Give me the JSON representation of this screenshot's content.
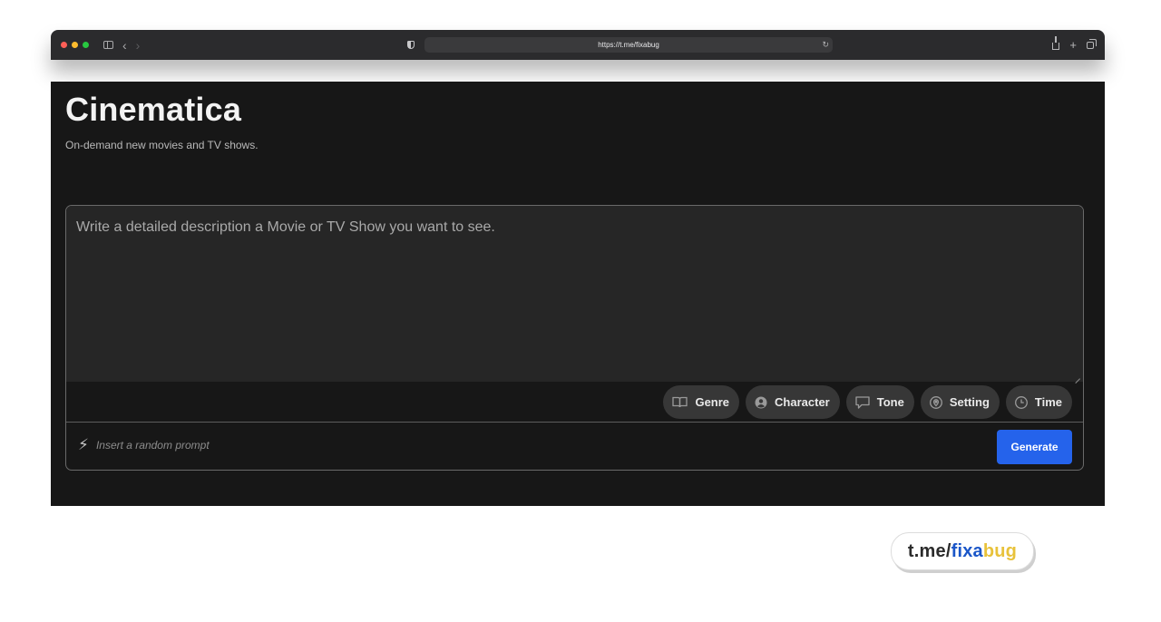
{
  "browser": {
    "url": "https://t.me/fixabug",
    "traffic_lights": [
      "#ff5f57",
      "#febc2e",
      "#28c840"
    ],
    "icons": [
      "sidebar-icon",
      "back-icon",
      "forward-icon",
      "shield-icon",
      "reload-icon",
      "share-icon",
      "new-tab-icon",
      "tabs-overview-icon"
    ]
  },
  "app": {
    "title": "Cinematica",
    "subtitle": "On-demand new movies and TV shows."
  },
  "prompt": {
    "placeholder": "Write a detailed description a Movie or TV Show you want to see.",
    "value": ""
  },
  "chips": [
    {
      "label": "Genre",
      "icon": "book-icon"
    },
    {
      "label": "Character",
      "icon": "user-circle-icon"
    },
    {
      "label": "Tone",
      "icon": "speech-bubble-icon"
    },
    {
      "label": "Setting",
      "icon": "map-pin-icon"
    },
    {
      "label": "Time",
      "icon": "clock-icon"
    }
  ],
  "random_prompt": {
    "label": "Insert a random prompt",
    "icon": "lightning-icon"
  },
  "generate": {
    "label": "Generate"
  },
  "watermark": {
    "prefix": "t.me/",
    "part1": "fixa",
    "part2": "bug"
  },
  "colors": {
    "page_bg": "#171717",
    "accent": "#2563eb",
    "watermark_blue": "#1a56c8",
    "watermark_yellow": "#e8c23a"
  }
}
